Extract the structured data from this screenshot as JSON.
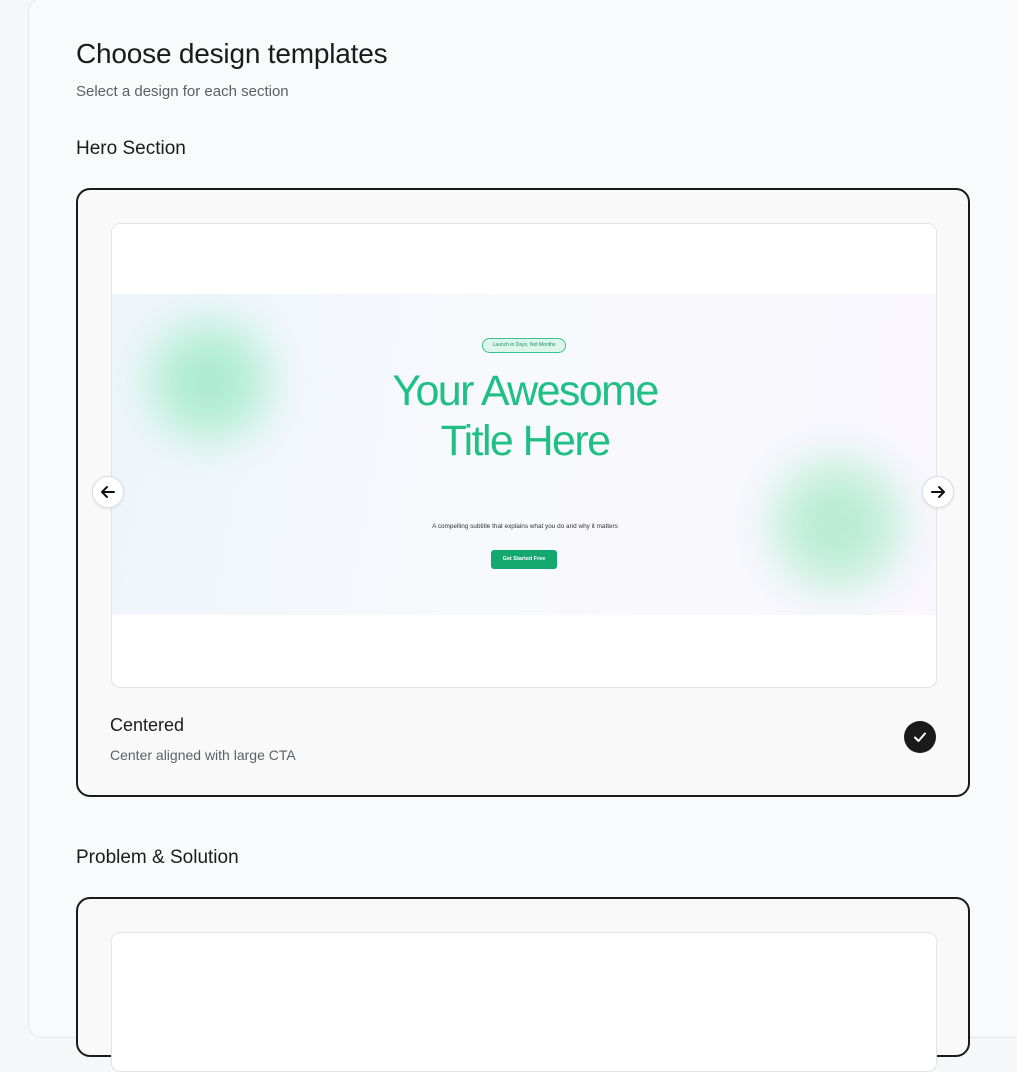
{
  "header": {
    "title": "Choose design templates",
    "subtitle": "Select a design for each section"
  },
  "sections": [
    {
      "heading": "Hero Section",
      "template": {
        "name": "Centered",
        "description": "Center aligned with large CTA",
        "selected": true,
        "preview": {
          "badge": "Launch in Days, Not Months",
          "title": "Your Awesome Title Here",
          "subtitle": "A compelling subtitle that explains what you do and why it matters",
          "cta": "Get Started Free",
          "accent_color": "#1fbf85",
          "cta_color": "#12a86f"
        }
      }
    },
    {
      "heading": "Problem & Solution"
    }
  ],
  "icons": {
    "prev": "arrow-left-icon",
    "next": "arrow-right-icon",
    "selected": "checkmark-icon"
  }
}
